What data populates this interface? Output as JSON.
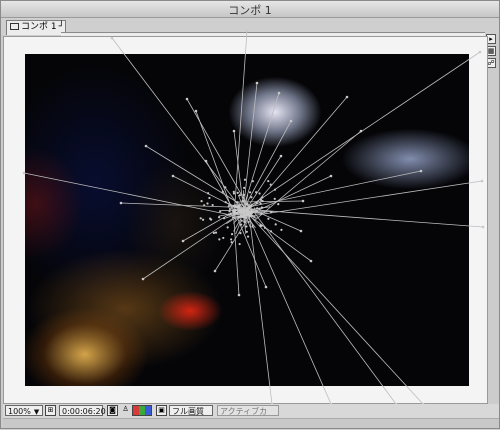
{
  "window": {
    "title": "コンポ 1"
  },
  "tab": {
    "label": "コンポ 1",
    "close_glyph": "┘"
  },
  "side_buttons": {
    "menu_glyph": "▸"
  },
  "statusbar": {
    "zoom": "100%",
    "zoom_arrow": "▼",
    "timecode": "0:00:06:20",
    "resolution": "フル画質",
    "resolution_arrow": "▼",
    "camera": "アクティブカメ...",
    "camera_arrow": "▼"
  },
  "colors": {
    "rgb_red": "#d83a3a",
    "rgb_green": "#3aa83a",
    "rgb_blue": "#3a5ad8"
  }
}
